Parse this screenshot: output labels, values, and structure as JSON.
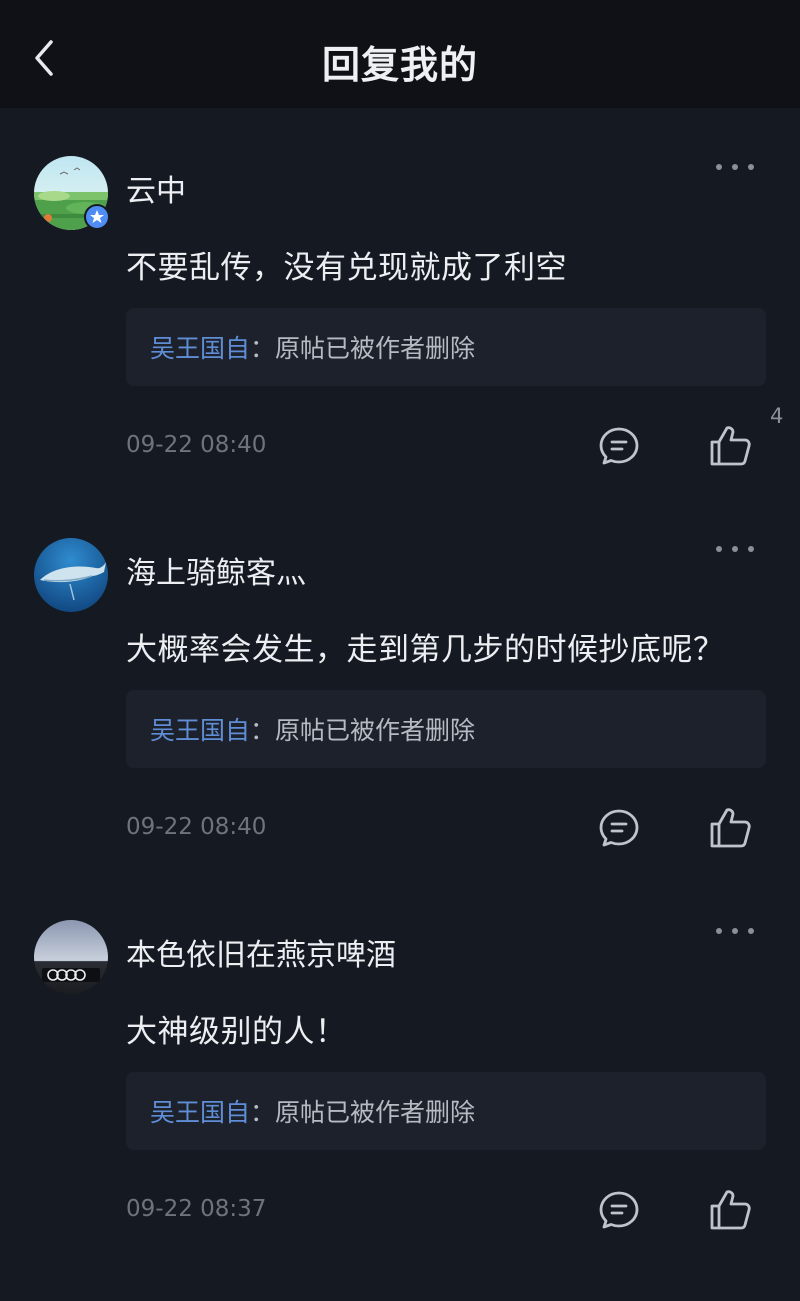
{
  "header": {
    "title": "回复我的",
    "back_icon": "chevron-left-icon"
  },
  "replies": [
    {
      "username": "云中",
      "avatar": "landscape-avatar",
      "verified": true,
      "text": "不要乱传，没有兑现就成了利空",
      "quote_author": "吴王国自",
      "quote_sep": "：",
      "quote_text": "原帖已被作者删除",
      "time": "09-22 08:40",
      "like_count": "4"
    },
    {
      "username": "海上骑鲸客灬",
      "avatar": "whale-avatar",
      "verified": false,
      "text": "大概率会发生，走到第几步的时候抄底呢？",
      "quote_author": "吴王国自",
      "quote_sep": "：",
      "quote_text": "原帖已被作者删除",
      "time": "09-22 08:40",
      "like_count": ""
    },
    {
      "username": "本色依旧在燕京啤酒",
      "avatar": "car-logo-avatar",
      "verified": false,
      "text": "大神级别的人！",
      "quote_author": "吴王国自",
      "quote_sep": "：",
      "quote_text": "原帖已被作者删除",
      "time": "09-22 08:37",
      "like_count": ""
    }
  ],
  "icons": {
    "more": "more-dots-icon",
    "comment": "comment-bubble-icon",
    "like": "thumbs-up-icon"
  },
  "colors": {
    "background": "#151a22",
    "header_bg": "#0f1116",
    "quote_bg": "#1d212b",
    "quote_author": "#5f8ed6",
    "muted": "#6e737d"
  }
}
